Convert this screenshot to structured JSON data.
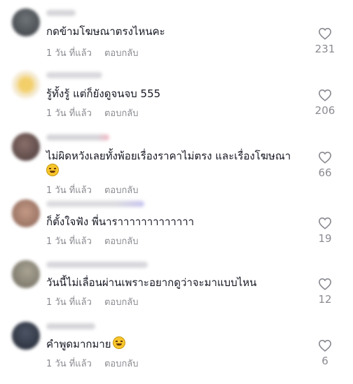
{
  "comments": [
    {
      "text": "กดข้ามโฆษณาตรงไหนคะ",
      "time": "1 วัน ที่แล้ว",
      "reply": "ตอบกลับ",
      "likes": "231"
    },
    {
      "text": "รู้ทั้งรู้ แต่ก็ยังดูจนจบ 555",
      "time": "1 วัน ที่แล้ว",
      "reply": "ตอบกลับ",
      "likes": "206"
    },
    {
      "text": "ไม่ผิดหวังเลยทั้งพ้อยเรื่องราคาไม่ตรง และเรื่องโฆษณา",
      "emoji": "grinning-face-emoji",
      "time": "1 วัน ที่แล้ว",
      "reply": "ตอบกลับ",
      "likes": "66"
    },
    {
      "text": "ก็ตั้งใจฟัง พี่นาราาาาาาาาาาาาา",
      "time": "1 วัน ที่แล้ว",
      "reply": "ตอบกลับ",
      "likes": "19"
    },
    {
      "text": "วันนี้ไม่เลื่อนผ่านเพราะอยากดูว่าจะมาแบบไหน",
      "time": "1 วัน ที่แล้ว",
      "reply": "ตอบกลับ",
      "likes": "12"
    },
    {
      "text": "คำพูดมากมาย",
      "emoji": "rolling-laughing-emoji",
      "time": "1 วัน ที่แล้ว",
      "reply": "ตอบกลับ",
      "likes": "6"
    }
  ],
  "colors": {
    "text": "#161823",
    "muted": "#8a8b91",
    "heart": "#8a8b91"
  },
  "icons": {
    "like": "heart-outline-icon"
  }
}
